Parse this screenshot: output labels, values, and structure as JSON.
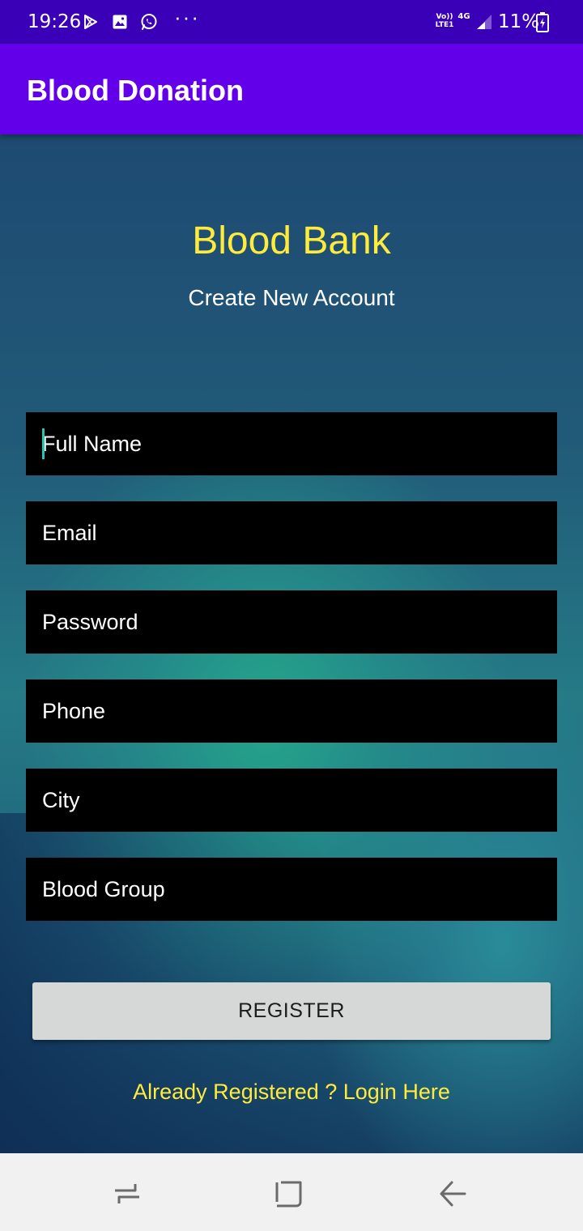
{
  "status_bar": {
    "time": "19:26",
    "icons": [
      "play-store-icon",
      "image-icon",
      "whatsapp-icon"
    ],
    "more": "···",
    "volte": "Vo))\nLTE1",
    "network": "4G",
    "battery": "11%"
  },
  "app_bar": {
    "title": "Blood Donation"
  },
  "form": {
    "heading": "Blood Bank",
    "subheading": "Create New Account",
    "fields": [
      {
        "placeholder": "Full Name"
      },
      {
        "placeholder": "Email"
      },
      {
        "placeholder": "Password"
      },
      {
        "placeholder": "Phone"
      },
      {
        "placeholder": "City"
      },
      {
        "placeholder": "Blood Group"
      }
    ],
    "register_label": "REGISTER",
    "login_link": "Already Registered ? Login Here"
  },
  "colors": {
    "status_bar": "#3a00b8",
    "app_bar": "#6200ea",
    "heading": "#ffeb3b",
    "field_bg": "#000000",
    "button_bg": "#d6d7d7",
    "nav_bar": "#f1f1f1"
  },
  "nav_bar": {
    "buttons": [
      "recents-icon",
      "home-icon",
      "back-icon"
    ]
  }
}
